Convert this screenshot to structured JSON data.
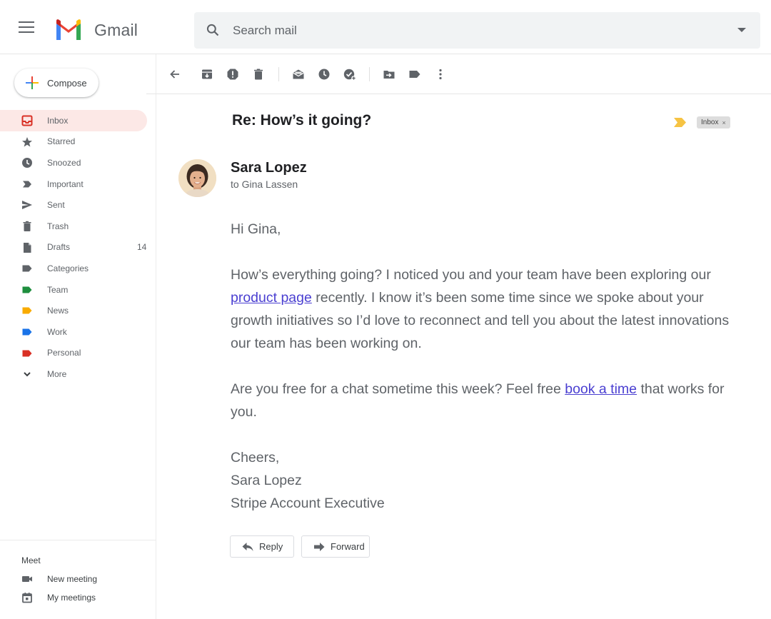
{
  "app": {
    "name": "Gmail"
  },
  "search": {
    "placeholder": "Search mail"
  },
  "compose": {
    "label": "Compose"
  },
  "sidebar": {
    "items": [
      {
        "label": "Inbox",
        "icon": "inbox-icon",
        "count": ""
      },
      {
        "label": "Starred",
        "icon": "star-icon",
        "count": ""
      },
      {
        "label": "Snoozed",
        "icon": "clock-icon",
        "count": ""
      },
      {
        "label": "Important",
        "icon": "important-icon",
        "count": ""
      },
      {
        "label": "Sent",
        "icon": "send-icon",
        "count": ""
      },
      {
        "label": "Trash",
        "icon": "trash-icon",
        "count": ""
      },
      {
        "label": "Drafts",
        "icon": "draft-icon",
        "count": "14"
      },
      {
        "label": "Categories",
        "icon": "label-icon",
        "count": ""
      },
      {
        "label": "Team",
        "icon": "label-icon",
        "count": ""
      },
      {
        "label": "News",
        "icon": "label-icon",
        "count": ""
      },
      {
        "label": "Work",
        "icon": "label-icon",
        "count": ""
      },
      {
        "label": "Personal",
        "icon": "label-icon",
        "count": ""
      },
      {
        "label": "More",
        "icon": "chevron-down-icon",
        "count": ""
      }
    ],
    "label_colors": {
      "categories": "#5f6368",
      "team": "#1e8e3e",
      "news": "#f9ab00",
      "work": "#1a73e8",
      "personal": "#d93025"
    }
  },
  "meet": {
    "title": "Meet",
    "new_meeting": "New meeting",
    "my_meetings": "My meetings"
  },
  "email": {
    "subject": "Re: How’s it going?",
    "label_chip": "Inbox",
    "chip_close": "×",
    "sender": "Sara Lopez",
    "recipient": "to Gina Lassen",
    "greeting": "Hi Gina,",
    "p1_before": "How’s everything going? I noticed you and your team have been exploring our ",
    "p1_link": "product page",
    "p1_after": " recently. I know it’s been some time since we spoke about your growth initiatives so I’d love to reconnect and tell you about the latest innovations our team has been working on.",
    "p2_before": "Are you free for a chat sometime this week? Feel free ",
    "p2_link": "book a time",
    "p2_after": " that works for you.",
    "sig_closing": "Cheers,",
    "sig_name": "Sara Lopez",
    "sig_title": "Stripe Account Executive"
  },
  "actions": {
    "reply": "Reply",
    "forward": "Forward"
  },
  "colors": {
    "accent_red": "#d93025",
    "active_bg": "#fce8e6",
    "link": "#4a3fd1",
    "important_marker": "#f6c343"
  }
}
